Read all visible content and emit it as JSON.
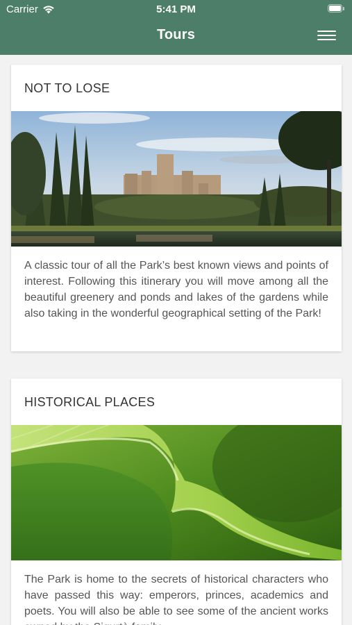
{
  "status_bar": {
    "carrier": "Carrier",
    "time": "5:41 PM"
  },
  "nav": {
    "title": "Tours",
    "menu_icon": "hamburger-menu-icon"
  },
  "colors": {
    "header": "#4c7e69",
    "background": "#f2f2f2",
    "card": "#ffffff"
  },
  "tours": [
    {
      "title": "NOT TO LOSE",
      "description": "A classic tour of all the Park’s best known views and points of interest. Following this itinerary you will move among all the beautiful greenery and ponds and lakes of the gardens while also taking in the wonderful geographical setting of the Park!"
    },
    {
      "title": "HISTORICAL PLACES",
      "description": "The Park is home to the secrets of historical characters who have passed this way: emperors, princes, academics and poets. You will also be able to see some of the ancient works owned by the Sigurtà family."
    }
  ]
}
